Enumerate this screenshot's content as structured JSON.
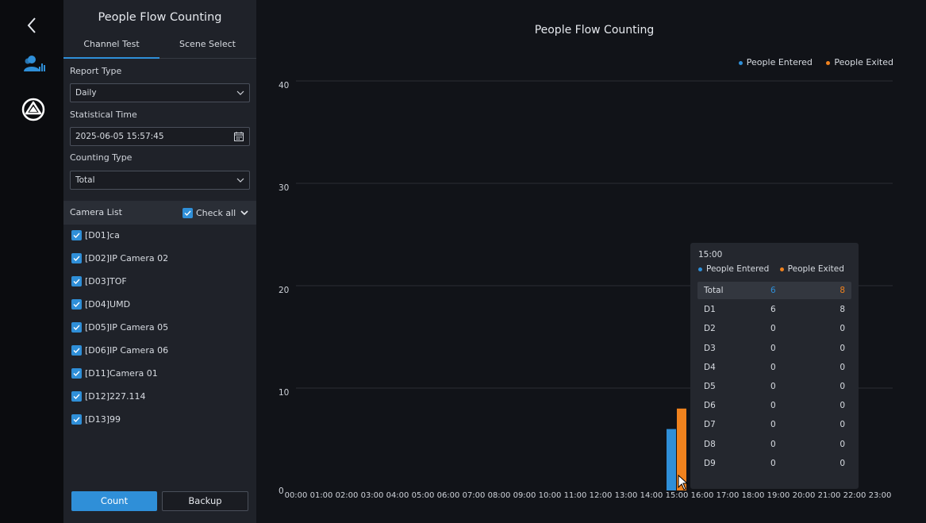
{
  "sidebar": {
    "panel_title": "People Flow Counting",
    "tabs": [
      {
        "label": "Channel Test",
        "active": true
      },
      {
        "label": "Scene Select",
        "active": false
      }
    ],
    "report_type": {
      "label": "Report Type",
      "value": "Daily"
    },
    "statistical_time": {
      "label": "Statistical Time",
      "value": "2025-06-05 15:57:45"
    },
    "counting_type": {
      "label": "Counting Type",
      "value": "Total"
    },
    "camera_list": {
      "label": "Camera List",
      "check_all_label": "Check all",
      "cameras": [
        {
          "label": "[D01]ca",
          "checked": true
        },
        {
          "label": "[D02]IP Camera 02",
          "checked": true
        },
        {
          "label": "[D03]TOF",
          "checked": true
        },
        {
          "label": "[D04]UMD",
          "checked": true
        },
        {
          "label": "[D05]IP Camera 05",
          "checked": true
        },
        {
          "label": "[D06]IP Camera 06",
          "checked": true
        },
        {
          "label": "[D11]Camera 01",
          "checked": true
        },
        {
          "label": "[D12]227.114",
          "checked": true
        },
        {
          "label": "[D13]99",
          "checked": true
        }
      ]
    },
    "buttons": {
      "count": "Count",
      "backup": "Backup"
    }
  },
  "chart_data": {
    "type": "bar",
    "title": "People Flow Counting",
    "categories": [
      "00:00",
      "01:00",
      "02:00",
      "03:00",
      "04:00",
      "05:00",
      "06:00",
      "07:00",
      "08:00",
      "09:00",
      "10:00",
      "11:00",
      "12:00",
      "13:00",
      "14:00",
      "15:00",
      "16:00",
      "17:00",
      "18:00",
      "19:00",
      "20:00",
      "21:00",
      "22:00",
      "23:00"
    ],
    "series": [
      {
        "name": "People Entered",
        "color": "#2f8fd8",
        "values": [
          0,
          0,
          0,
          0,
          0,
          0,
          0,
          0,
          0,
          0,
          0,
          0,
          0,
          0,
          0,
          6,
          0,
          0,
          0,
          0,
          0,
          0,
          0,
          0
        ]
      },
      {
        "name": "People Exited",
        "color": "#f0821e",
        "values": [
          0,
          0,
          0,
          0,
          0,
          0,
          0,
          0,
          0,
          0,
          0,
          0,
          0,
          0,
          0,
          8,
          0,
          0,
          0,
          0,
          0,
          0,
          0,
          0
        ]
      }
    ],
    "ylim": [
      0,
      40
    ],
    "yticks": [
      0,
      10,
      20,
      30,
      40
    ],
    "grid": true,
    "legend": "top-right"
  },
  "tooltip": {
    "time": "15:00",
    "legend": [
      "People Entered",
      "People Exited"
    ],
    "rows": [
      {
        "name": "Total",
        "entered": "6",
        "exited": "8"
      },
      {
        "name": "D1",
        "entered": "6",
        "exited": "8"
      },
      {
        "name": "D2",
        "entered": "0",
        "exited": "0"
      },
      {
        "name": "D3",
        "entered": "0",
        "exited": "0"
      },
      {
        "name": "D4",
        "entered": "0",
        "exited": "0"
      },
      {
        "name": "D5",
        "entered": "0",
        "exited": "0"
      },
      {
        "name": "D6",
        "entered": "0",
        "exited": "0"
      },
      {
        "name": "D7",
        "entered": "0",
        "exited": "0"
      },
      {
        "name": "D8",
        "entered": "0",
        "exited": "0"
      },
      {
        "name": "D9",
        "entered": "0",
        "exited": "0"
      }
    ]
  },
  "icons": {
    "back": "chevron-left-icon",
    "people_stats": "people-chart-icon",
    "app_logo": "triangle-logo-icon",
    "calendar": "calendar-icon",
    "dropdown": "chevron-down-icon",
    "checkbox": "check-icon"
  },
  "colors": {
    "accent": "#2f8fd8",
    "entered": "#2f8fd8",
    "exited": "#f0821e"
  }
}
